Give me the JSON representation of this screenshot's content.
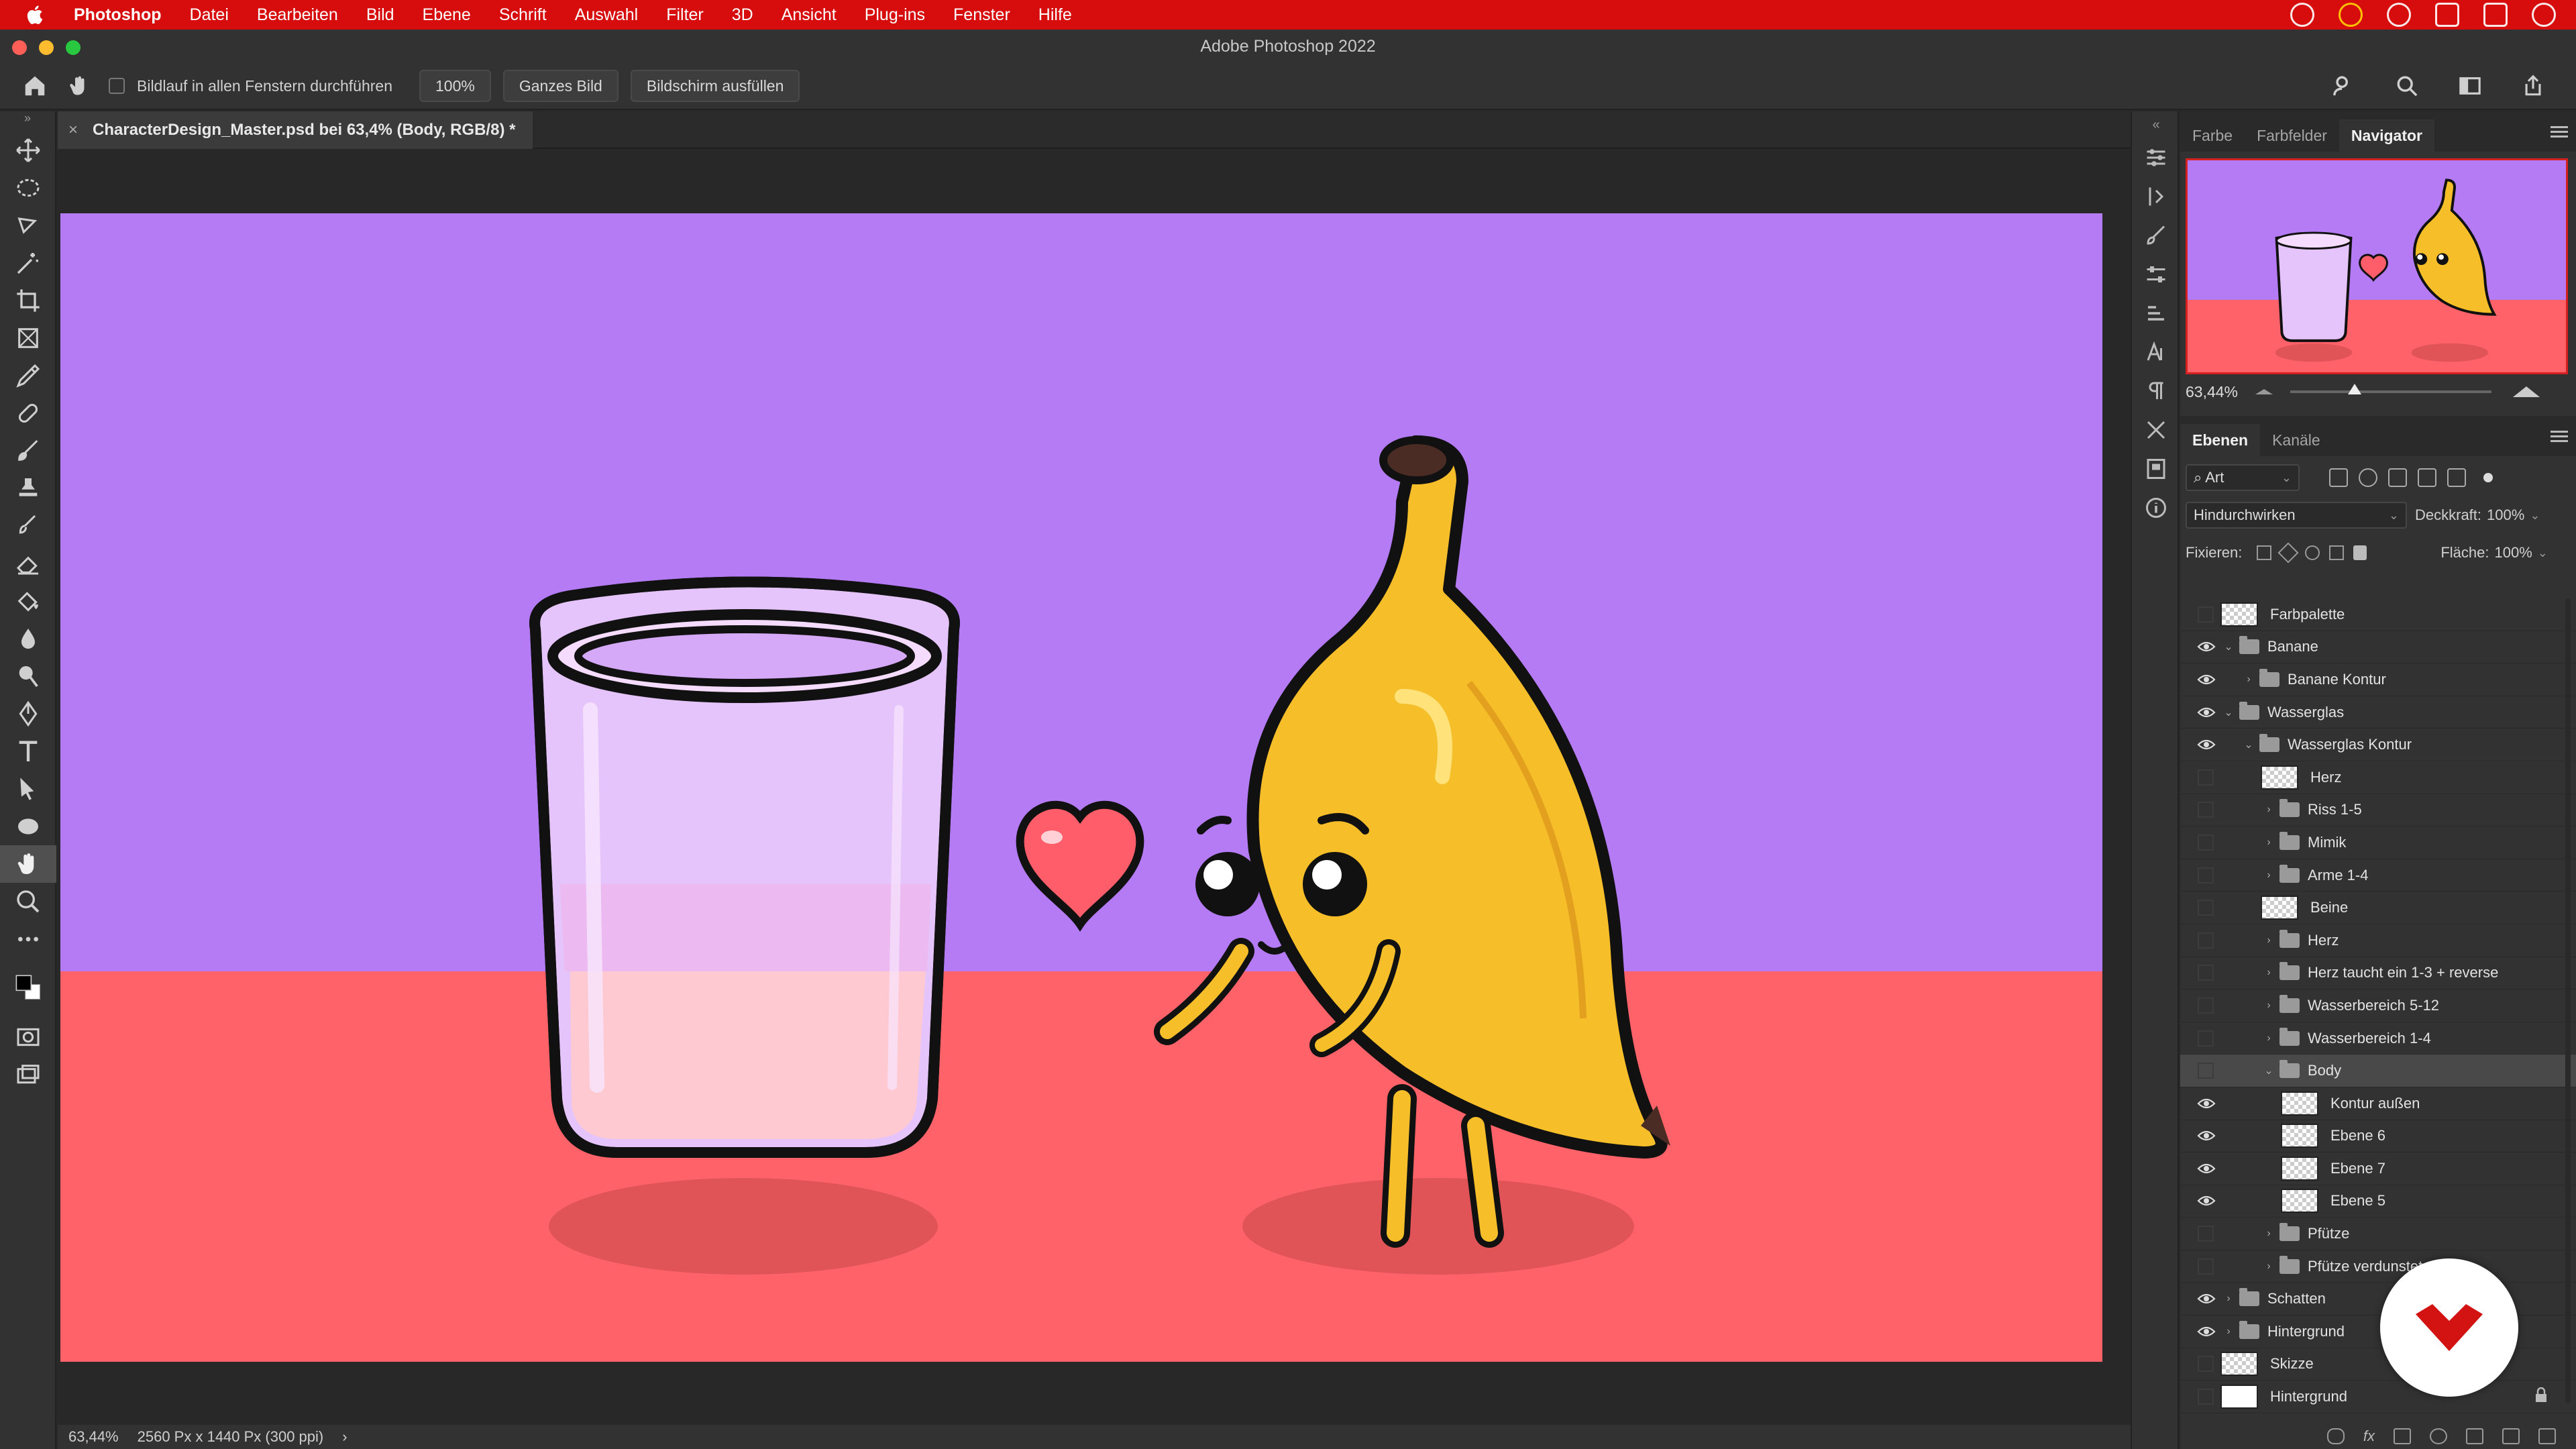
{
  "menubar": {
    "items": [
      "Photoshop",
      "Datei",
      "Bearbeiten",
      "Bild",
      "Ebene",
      "Schrift",
      "Auswahl",
      "Filter",
      "3D",
      "Ansicht",
      "Plug-ins",
      "Fenster",
      "Hilfe"
    ]
  },
  "window": {
    "title": "Adobe Photoshop 2022"
  },
  "options": {
    "scroll_all_label": "Bildlauf in allen Fenstern durchführen",
    "zoom_btn": "100%",
    "fit_btn": "Ganzes Bild",
    "fill_btn": "Bildschirm ausfüllen"
  },
  "document": {
    "tab_close": "×",
    "tab_title": "CharacterDesign_Master.psd bei 63,4% (Body, RGB/8) *"
  },
  "status": {
    "zoom": "63,44%",
    "dimensions": "2560 Px x 1440 Px (300 ppi)",
    "arrow": "›"
  },
  "panels": {
    "top_tabs": [
      "Farbe",
      "Farbfelder",
      "Navigator"
    ],
    "navigator_zoom": "63,44%",
    "navigator_zoom_fraction": 0.32,
    "layer_tabs": [
      "Ebenen",
      "Kanäle"
    ],
    "filter_kind": "Art",
    "blend_mode": "Hindurchwirken",
    "opacity_label": "Deckkraft:",
    "opacity_value": "100%",
    "lock_label": "Fixieren:",
    "fill_label": "Fläche:",
    "fill_value": "100%"
  },
  "layers": [
    {
      "name": "Farbpalette",
      "type": "layer",
      "depth": 0,
      "visible": false,
      "disclosure": ""
    },
    {
      "name": "Banane",
      "type": "group",
      "depth": 0,
      "visible": true,
      "disclosure": "⌄"
    },
    {
      "name": "Banane Kontur",
      "type": "group",
      "depth": 1,
      "visible": true,
      "disclosure": "›"
    },
    {
      "name": "Wasserglas",
      "type": "group",
      "depth": 0,
      "visible": true,
      "disclosure": "⌄"
    },
    {
      "name": "Wasserglas Kontur",
      "type": "group",
      "depth": 1,
      "visible": true,
      "disclosure": "⌄"
    },
    {
      "name": "Herz",
      "type": "layer",
      "depth": 2,
      "visible": false,
      "disclosure": ""
    },
    {
      "name": "Riss 1-5",
      "type": "group",
      "depth": 2,
      "visible": false,
      "disclosure": "›"
    },
    {
      "name": "Mimik",
      "type": "group",
      "depth": 2,
      "visible": false,
      "disclosure": "›"
    },
    {
      "name": "Arme 1-4",
      "type": "group",
      "depth": 2,
      "visible": false,
      "disclosure": "›"
    },
    {
      "name": "Beine",
      "type": "layer",
      "depth": 2,
      "visible": false,
      "disclosure": ""
    },
    {
      "name": "Herz",
      "type": "group",
      "depth": 2,
      "visible": false,
      "disclosure": "›"
    },
    {
      "name": "Herz taucht ein 1-3 + reverse",
      "type": "group",
      "depth": 2,
      "visible": false,
      "disclosure": "›"
    },
    {
      "name": "Wasserbereich 5-12",
      "type": "group",
      "depth": 2,
      "visible": false,
      "disclosure": "›"
    },
    {
      "name": "Wasserbereich 1-4",
      "type": "group",
      "depth": 2,
      "visible": false,
      "disclosure": "›"
    },
    {
      "name": "Body",
      "type": "group",
      "depth": 2,
      "visible": false,
      "disclosure": "⌄",
      "selected": true
    },
    {
      "name": "Kontur außen",
      "type": "layer",
      "depth": 3,
      "visible": true,
      "disclosure": ""
    },
    {
      "name": "Ebene 6",
      "type": "layer",
      "depth": 3,
      "visible": true,
      "disclosure": ""
    },
    {
      "name": "Ebene 7",
      "type": "layer",
      "depth": 3,
      "visible": true,
      "disclosure": ""
    },
    {
      "name": "Ebene 5",
      "type": "layer",
      "depth": 3,
      "visible": true,
      "disclosure": ""
    },
    {
      "name": "Pfütze",
      "type": "group",
      "depth": 2,
      "visible": false,
      "disclosure": "›"
    },
    {
      "name": "Pfütze verdunstet",
      "type": "group",
      "depth": 2,
      "visible": false,
      "disclosure": "›"
    },
    {
      "name": "Schatten",
      "type": "group",
      "depth": 0,
      "visible": true,
      "disclosure": "›"
    },
    {
      "name": "Hintergrund",
      "type": "group",
      "depth": 0,
      "visible": true,
      "disclosure": "›"
    },
    {
      "name": "Skizze",
      "type": "layer",
      "depth": 0,
      "visible": false,
      "disclosure": ""
    },
    {
      "name": "Hintergrund",
      "type": "layer-white",
      "depth": 0,
      "visible": false,
      "disclosure": "",
      "locked": true
    }
  ],
  "colors": {
    "menubar": "#d70c0c",
    "canvas_sky": "#b57bf5",
    "canvas_floor": "#ff6369",
    "banana": "#f6bf2a"
  }
}
